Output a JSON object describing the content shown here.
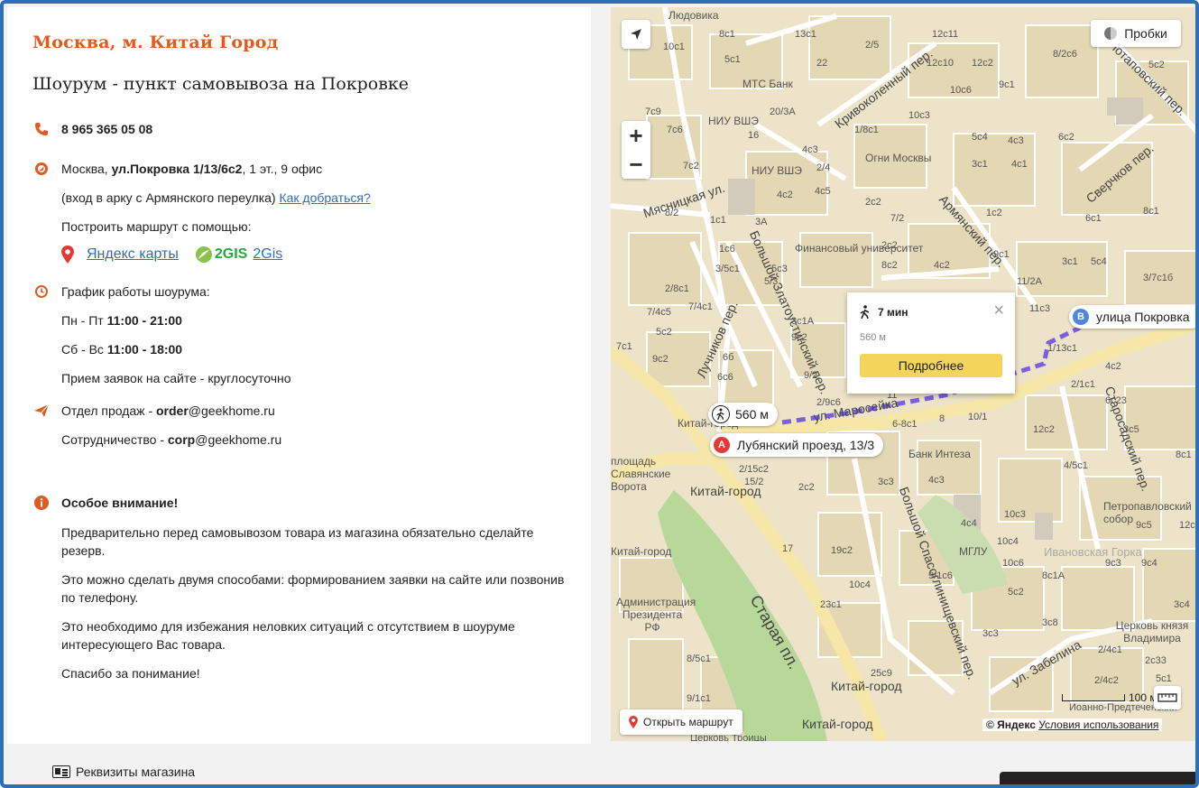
{
  "store": {
    "city": "Москва, м. Китай Город",
    "title": "Шоурум - пункт самовывоза на Покровке",
    "phone": "8 965 365 05 08",
    "address_prefix": "Москва, ",
    "address_street": "ул.Покровка 1/13/6с2",
    "address_suffix": ", 1 эт., 9 офис",
    "entrance_note": "(вход в арку с Армянского переулка)",
    "directions_link": "Как добраться?",
    "route_prompt": "Построить маршрут с помощью:",
    "yandex_maps_link": "Яндекс карты",
    "gis_logo": "2GIS",
    "gis_link": "2Gis",
    "schedule_title": "График работы шоурума:",
    "weekday_label": "Пн - Пт ",
    "weekday_hours": "11:00 - 21:00",
    "weekend_label": "Сб - Вс ",
    "weekend_hours": "11:00 - 18:00",
    "online_orders": "Прием заявок на сайте - круглосуточно",
    "sales_label": "Отдел продаж - ",
    "sales_email_user": "order",
    "sales_email_domain": "@geekhome.ru",
    "partner_label": "Сотрудничество - ",
    "partner_email_user": "corp",
    "partner_email_domain": "@geekhome.ru"
  },
  "attention": {
    "title": "Особое внимание!",
    "paragraphs": [
      "Предварительно перед самовывозом товара из магазина обязательно сделайте резерв.",
      "Это можно сделать двумя способами: формированием заявки на сайте или позвонив по телефону.",
      "Это необходимо для избежания неловких ситуаций с отсутствием в шоуруме интересующего Вас товара.",
      "Спасибо за понимание!"
    ]
  },
  "map": {
    "traffic_label": "Пробки",
    "popup_time": "7 мин",
    "popup_distance": "560 м",
    "popup_button": "Подробнее",
    "route_distance": "560 м",
    "point_a_letter": "A",
    "point_a_label": "Лубянский проезд, 13/3",
    "point_b_letter": "B",
    "point_b_label": "улица Покровка",
    "open_route": "Открыть маршрут",
    "copyright": "© Яндекс",
    "terms": "Условия использования",
    "scale": "100 м",
    "labels": [
      "Людовика",
      "МТС Банк",
      "НИУ ВШЭ",
      "НИУ ВШЭ",
      "Огни Москвы",
      "Мясницкая ул.",
      "Финансовый университет",
      "Кривоколенный пер.",
      "Армянский пер.",
      "Потаповский пер.",
      "Сверчков пер.",
      "ул. Маросейка",
      "Банк Интеза",
      "Китай-город",
      "Китай-город",
      "площадь Славянские Ворота",
      "Администрация Президента РФ",
      "Старая пл.",
      "МГЛУ",
      "Ивановская Горка",
      "Петропавловский собор",
      "Церковь князя Владимира",
      "ул. Забелина",
      "Старосадский пер.",
      "Лучников пер.",
      "Большой Златоустинский пер.",
      "Большой Спасоглинищевский пер.",
      "Китай-город",
      "Китай-город",
      "Иоанно-Предтеченский",
      "Церковь Троицы",
      "Китай-город"
    ],
    "house_numbers": [
      "8с1",
      "13с1",
      "2/5",
      "12с11",
      "10с1",
      "5с1",
      "22",
      "12с10",
      "12с2",
      "8/2с6",
      "5с2",
      "7с9",
      "20/3А",
      "10с6",
      "9с1",
      "7с6",
      "16",
      "4с3",
      "10с3",
      "5с4",
      "4с3",
      "6с2",
      "7с2",
      "1/8с1",
      "3с1",
      "4с1",
      "2/4",
      "3с1",
      "8/2",
      "1с1",
      "3А",
      "4с2",
      "4с5",
      "2с2",
      "1с2",
      "7/2",
      "6с1",
      "8с1",
      "1с6",
      "2с2",
      "3/5с1",
      "5с3",
      "8с2",
      "4с2",
      "9с1",
      "3с1",
      "5с4",
      "3/7с1б",
      "2/8с1",
      "5/3",
      "11/2А",
      "7/4с5",
      "7/4с1",
      "5с2",
      "3с1А",
      "9с2",
      "11с3",
      "7с1",
      "9с2",
      "6б",
      "6с6",
      "9/2",
      "2/9с6",
      "11",
      "1/13с1",
      "4с2",
      "2/1с1",
      "6с23",
      "6-8с1",
      "8",
      "10/1",
      "12с2",
      "3с5",
      "8с1",
      "2/15с2",
      "15/2",
      "2с2",
      "3с3",
      "4с3",
      "4/5с1",
      "9с5",
      "12с3",
      "17",
      "19с2",
      "4с4",
      "10с4",
      "10с3",
      "10с6",
      "8с1А",
      "9с3",
      "9с4",
      "10с4",
      "23с1",
      "9/1с6",
      "5с2",
      "8/5с1",
      "3с4",
      "3с3",
      "3с8",
      "2/4с1",
      "2с33",
      "9/1с1",
      "25с9",
      "2/4с2",
      "5с1"
    ]
  },
  "footer": {
    "requisites": "Реквизиты магазина"
  },
  "colors": {
    "accent_orange": "#e15a22",
    "link_blue": "#2f6fb7",
    "frame_blue": "#2d6fb8",
    "route_purple": "#7b5fe0",
    "pin_red": "#e53935",
    "pin_blue": "#4f87e0",
    "popup_button": "#f4d55b"
  }
}
